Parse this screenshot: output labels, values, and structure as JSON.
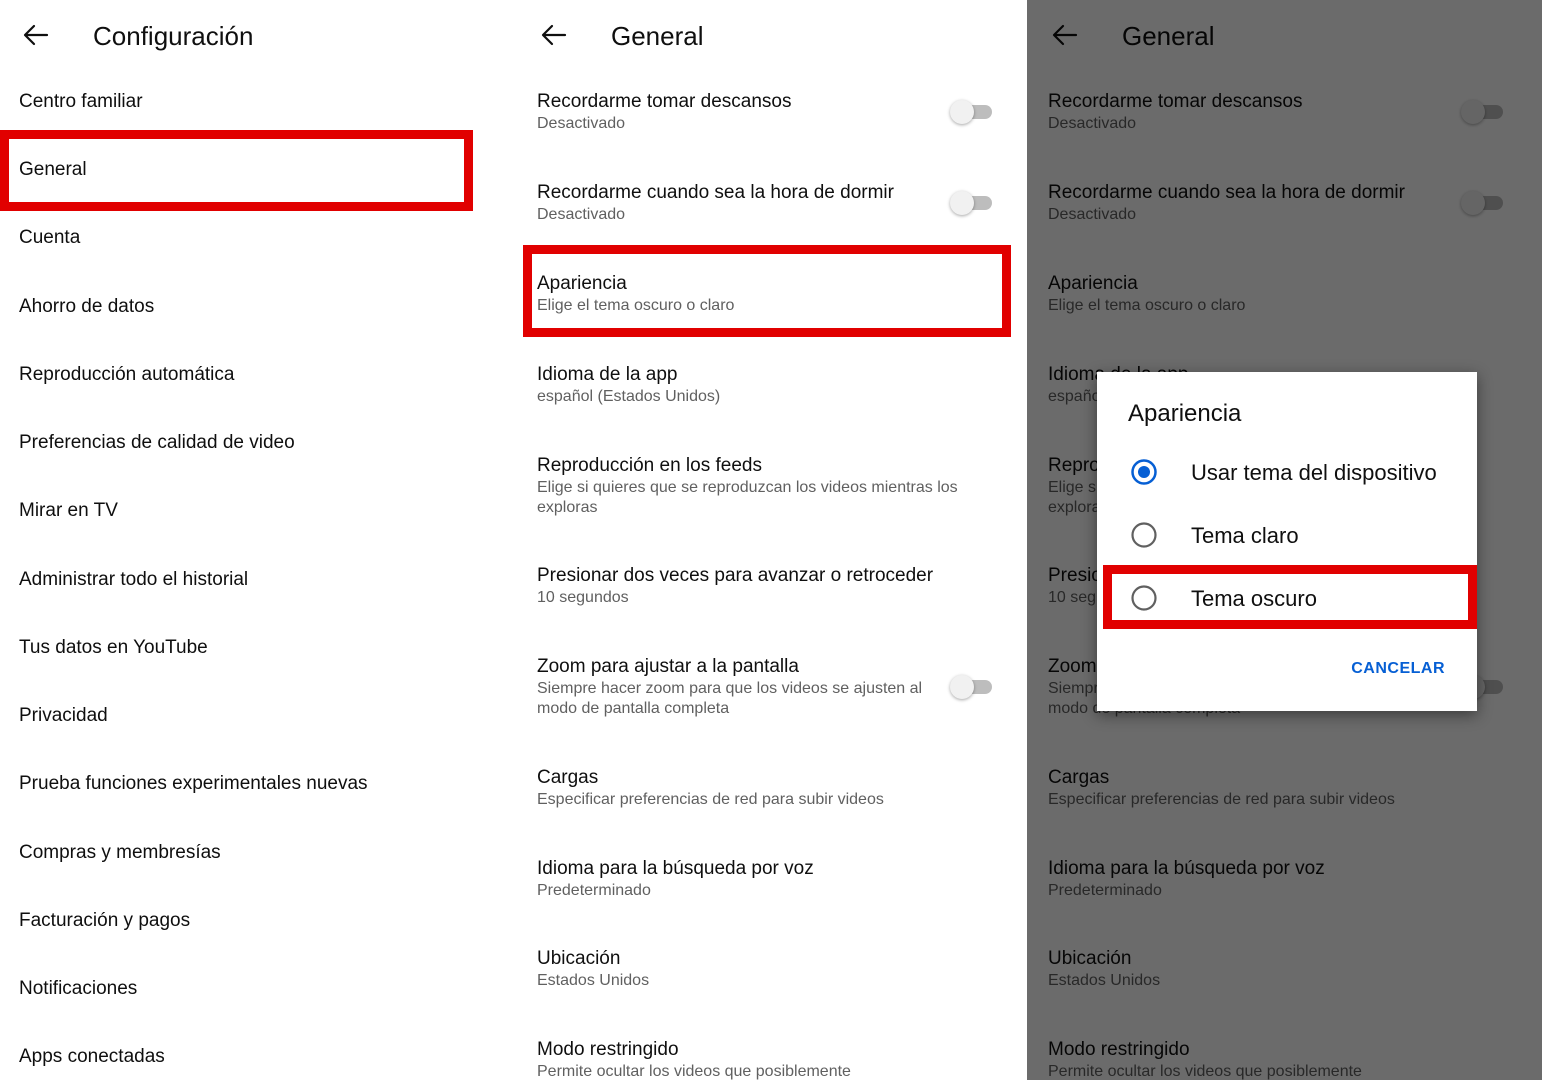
{
  "panel1": {
    "title": "Configuración",
    "items": [
      {
        "label": "Centro familiar"
      },
      {
        "label": "General"
      },
      {
        "label": "Cuenta"
      },
      {
        "label": "Ahorro de datos"
      },
      {
        "label": "Reproducción automática"
      },
      {
        "label": "Preferencias de calidad de video"
      },
      {
        "label": "Mirar en TV"
      },
      {
        "label": "Administrar todo el historial"
      },
      {
        "label": "Tus datos en YouTube"
      },
      {
        "label": "Privacidad"
      },
      {
        "label": "Prueba funciones experimentales nuevas"
      },
      {
        "label": "Compras y membresías"
      },
      {
        "label": "Facturación y pagos"
      },
      {
        "label": "Notificaciones"
      },
      {
        "label": "Apps conectadas"
      }
    ]
  },
  "general": {
    "title": "General",
    "settings": [
      {
        "title": "Recordarme tomar descansos",
        "subtitle": "Desactivado",
        "toggle": false
      },
      {
        "title": "Recordarme cuando sea la hora de dormir",
        "subtitle": "Desactivado",
        "toggle": false
      },
      {
        "title": "Apariencia",
        "subtitle": "Elige el tema oscuro o claro"
      },
      {
        "title": "Idioma de la app",
        "subtitle": "español (Estados Unidos)"
      },
      {
        "title": "Reproducción en los feeds",
        "subtitle": "Elige si quieres que se reproduzcan los videos mientras los exploras"
      },
      {
        "title": "Presionar dos veces para avanzar o retroceder",
        "subtitle": "10 segundos"
      },
      {
        "title": "Zoom para ajustar a la pantalla",
        "subtitle": "Siempre hacer zoom para que los videos se ajusten al modo de pantalla completa",
        "toggle": false
      },
      {
        "title": "Cargas",
        "subtitle": "Especificar preferencias de red para subir videos"
      },
      {
        "title": "Idioma para la búsqueda por voz",
        "subtitle": "Predeterminado"
      },
      {
        "title": "Ubicación",
        "subtitle": "Estados Unidos"
      },
      {
        "title": "Modo restringido",
        "subtitle": "Permite ocultar los videos que posiblemente"
      }
    ]
  },
  "dialog": {
    "title": "Apariencia",
    "options": [
      {
        "label": "Usar tema del dispositivo",
        "selected": true
      },
      {
        "label": "Tema claro",
        "selected": false
      },
      {
        "label": "Tema oscuro",
        "selected": false
      }
    ],
    "cancel_label": "CANCELAR"
  },
  "colors": {
    "highlight": "#e10000",
    "accent": "#065fd4"
  }
}
